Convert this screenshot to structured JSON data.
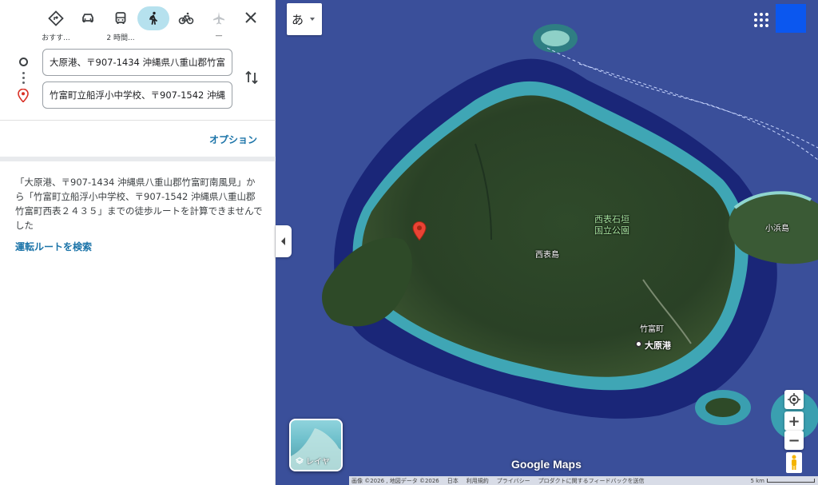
{
  "travel_modes": [
    {
      "name": "best",
      "icon": "diamond-directions-icon",
      "sub": "おすす..."
    },
    {
      "name": "drive",
      "icon": "car-icon",
      "sub": ""
    },
    {
      "name": "transit",
      "icon": "bus-icon",
      "sub": "2 時間..."
    },
    {
      "name": "walk",
      "icon": "walk-icon",
      "sub": "",
      "active": true
    },
    {
      "name": "bicycle",
      "icon": "bicycle-icon",
      "sub": ""
    },
    {
      "name": "flight",
      "icon": "airplane-icon",
      "sub": "—"
    }
  ],
  "directions": {
    "start_value": "大原港、〒907-1434 沖縄県八重山郡竹富町南風見",
    "destination_value": "竹富町立船浮小中学校、〒907-1542 沖縄県八重山郡竹富町西表２４３５"
  },
  "options_label": "オプション",
  "message": "「大原港、〒907-1434 沖縄県八重山郡竹富町南風見」から「竹富町立船浮小中学校、〒907-1542 沖縄県八重山郡竹富町西表２４３５」までの徒歩ルートを計算できませんでした",
  "drive_link": "運転ルートを検索",
  "map": {
    "ime_char": "あ",
    "labels": {
      "park": "西表石垣\n国立公園",
      "island": "西表島",
      "kohama": "小浜島",
      "taketomi": "竹富町",
      "ohara_port": "大原港"
    },
    "layer_label": "レイヤ",
    "logo": "Google Maps",
    "footer": {
      "imagery": "画像 ©2026 , 地図データ ©2026",
      "country": "日本",
      "terms": "利用規約",
      "privacy": "プライバシー",
      "feedback": "プロダクトに関するフィードバックを送信",
      "scale": "5 km"
    }
  },
  "colors": {
    "accent": "#1a73a8",
    "active_mode_bg": "#b6e1ee",
    "ocean": "#2b3e8e",
    "account": "#0b57ef"
  }
}
